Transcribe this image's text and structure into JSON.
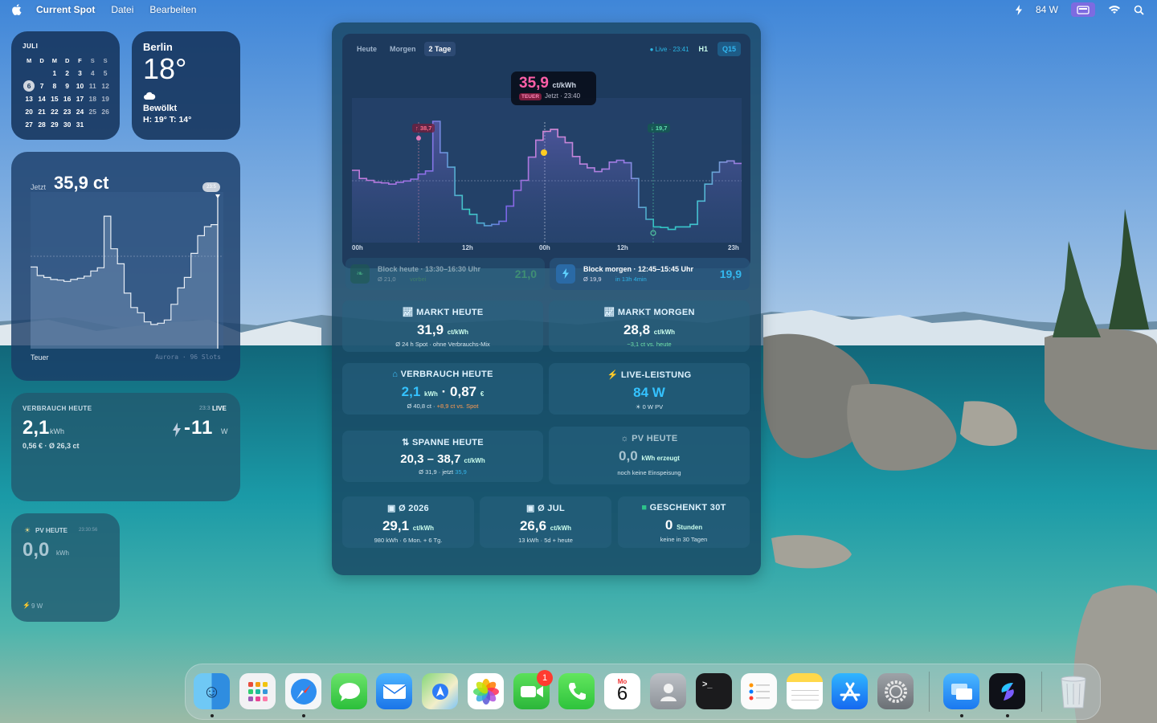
{
  "menubar": {
    "app": "Current Spot",
    "menus": [
      "Datei",
      "Bearbeiten"
    ],
    "power": "84 W"
  },
  "calendar": {
    "month": "JULI",
    "weekdays": [
      "M",
      "D",
      "M",
      "D",
      "F",
      "S",
      "S"
    ],
    "weeks": [
      [
        "",
        "",
        "1",
        "2",
        "3",
        "4",
        "5"
      ],
      [
        "6",
        "7",
        "8",
        "9",
        "10",
        "11",
        "12"
      ],
      [
        "13",
        "14",
        "15",
        "16",
        "17",
        "18",
        "19"
      ],
      [
        "20",
        "21",
        "22",
        "23",
        "24",
        "25",
        "26"
      ],
      [
        "27",
        "28",
        "29",
        "30",
        "31",
        "",
        ""
      ]
    ],
    "today": "6"
  },
  "weather": {
    "city": "Berlin",
    "temp": "18°",
    "condition": "Bewölkt",
    "hilo": "H: 19° T: 14°"
  },
  "price_widget": {
    "now_label": "Jetzt",
    "value": "35,9 ct",
    "bottom_left": "Teuer",
    "bottom_right": "Aurora · 96 Slots",
    "badge": "23:5"
  },
  "consumption_widget": {
    "title": "VERBRAUCH HEUTE",
    "time": "23:3",
    "live": "LIVE",
    "value": "2,1",
    "unit": "kWh",
    "live_value": "-11",
    "live_unit": "W",
    "sub": "0,56 € · Ø 26,3 ct"
  },
  "pv_widget": {
    "title": "PV HEUTE",
    "time": "23:30:56",
    "value": "0,0",
    "unit": "kWh",
    "footer": "9 W"
  },
  "main": {
    "tabs": [
      "Heute",
      "Morgen",
      "2 Tage"
    ],
    "active_tab": "2 Tage",
    "live": "● Live · 23:41",
    "res": [
      "H1",
      "Q15"
    ],
    "tooltip": {
      "value": "35,9",
      "unit": "ct/kWh",
      "tag": "TEUER",
      "sub": "Jetzt · 23:40"
    },
    "max_badge": "↑ 38,7",
    "min_badge": "↓ 19,7",
    "xticks": [
      "00h",
      "12h",
      "00h",
      "12h",
      "23h"
    ],
    "block_today": {
      "title": "Block heute · 13:30–16:30 Uhr",
      "sub": "Ø 21,0",
      "status": "vorbei",
      "value": "21,0"
    },
    "block_tomorrow": {
      "title": "Block morgen · 12:45–15:45 Uhr",
      "sub": "Ø 19,9",
      "eta": "in 13h 4min",
      "value": "19,9"
    },
    "cards": {
      "markt_heute": {
        "title": "MARKT HEUTE",
        "value": "31,9",
        "unit": "ct/kWh",
        "sub": "Ø 24 h Spot · ohne Verbrauchs-Mix"
      },
      "markt_morgen": {
        "title": "MARKT MORGEN",
        "value": "28,8",
        "unit": "ct/kWh",
        "sub": "−3,1 ct vs. heute"
      },
      "verbrauch": {
        "title": "VERBRAUCH HEUTE",
        "value": "2,1",
        "unit": "kWh",
        "cost": "0,87",
        "cost_unit": "€",
        "sub": "Ø 40,8 ct",
        "sub2": "+8,9 ct vs. Spot"
      },
      "leistung": {
        "title": "LIVE-LEISTUNG",
        "value": "84 W",
        "sub": "☀ 0 W PV"
      },
      "spanne": {
        "title": "SPANNE HEUTE",
        "value": "20,3 – 38,7",
        "unit": "ct/kWh",
        "sub": "Ø 31,9 · jetzt",
        "now": "35,9"
      },
      "pv": {
        "title": "PV HEUTE",
        "value": "0,0",
        "unit": "kWh erzeugt",
        "sub": "noch keine Einspeisung"
      },
      "y2026": {
        "title": "Ø 2026",
        "value": "29,1",
        "unit": "ct/kWh",
        "sub": "980 kWh · 6 Mon. + 6 Tg."
      },
      "jul": {
        "title": "Ø JUL",
        "value": "26,6",
        "unit": "ct/kWh",
        "sub": "13 kWh · 5d + heute"
      },
      "geschenkt": {
        "title": "GESCHENKT 30T",
        "value": "0",
        "unit": "Stunden",
        "sub": "keine in 30 Tagen"
      }
    }
  },
  "chart_data": {
    "type": "line",
    "x_label": "",
    "xticks": [
      "00h",
      "12h",
      "00h",
      "12h",
      "23h"
    ],
    "series": [
      {
        "values": [
          28.5,
          27.2,
          26.9,
          26.6,
          26.5,
          26.3,
          26.6,
          26.8,
          27.1,
          27.9,
          28.4,
          36.3,
          31.3,
          29.0,
          24.5,
          22.3,
          21.5,
          20.1,
          19.7,
          19.9,
          20.4,
          22.8,
          25.3,
          26.9,
          30.6,
          33.3,
          34.7,
          35.0,
          33.8,
          32.9,
          30.7,
          29.5,
          28.9,
          28.3,
          28.7,
          29.8,
          30.1,
          29.7,
          27.2,
          22.6,
          20.7,
          19.5,
          19.4,
          19.1,
          19.5,
          19.5,
          19.9,
          23.6,
          26.3,
          28.2,
          29.8,
          30.0,
          29.6
        ]
      }
    ],
    "markers": {
      "max": 38.7,
      "min": 19.7,
      "now": 35.9
    }
  },
  "dock": {
    "calendar_day": "Mo",
    "calendar_date": "6",
    "facetime_badge": "1"
  }
}
